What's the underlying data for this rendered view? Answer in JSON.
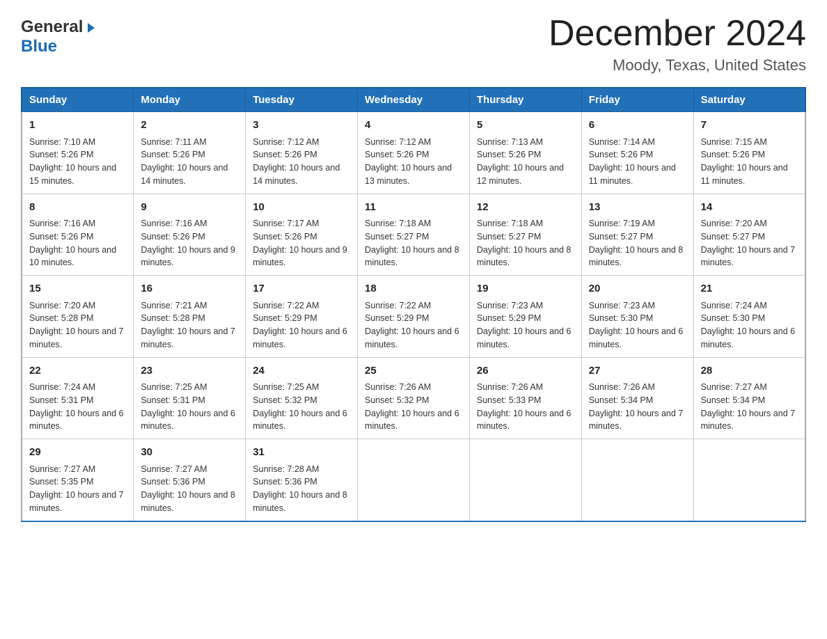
{
  "header": {
    "logo_line1": "General",
    "logo_line2": "Blue",
    "title": "December 2024",
    "subtitle": "Moody, Texas, United States"
  },
  "days_of_week": [
    "Sunday",
    "Monday",
    "Tuesday",
    "Wednesday",
    "Thursday",
    "Friday",
    "Saturday"
  ],
  "weeks": [
    [
      {
        "day": "1",
        "sunrise": "7:10 AM",
        "sunset": "5:26 PM",
        "daylight": "10 hours and 15 minutes."
      },
      {
        "day": "2",
        "sunrise": "7:11 AM",
        "sunset": "5:26 PM",
        "daylight": "10 hours and 14 minutes."
      },
      {
        "day": "3",
        "sunrise": "7:12 AM",
        "sunset": "5:26 PM",
        "daylight": "10 hours and 14 minutes."
      },
      {
        "day": "4",
        "sunrise": "7:12 AM",
        "sunset": "5:26 PM",
        "daylight": "10 hours and 13 minutes."
      },
      {
        "day": "5",
        "sunrise": "7:13 AM",
        "sunset": "5:26 PM",
        "daylight": "10 hours and 12 minutes."
      },
      {
        "day": "6",
        "sunrise": "7:14 AM",
        "sunset": "5:26 PM",
        "daylight": "10 hours and 11 minutes."
      },
      {
        "day": "7",
        "sunrise": "7:15 AM",
        "sunset": "5:26 PM",
        "daylight": "10 hours and 11 minutes."
      }
    ],
    [
      {
        "day": "8",
        "sunrise": "7:16 AM",
        "sunset": "5:26 PM",
        "daylight": "10 hours and 10 minutes."
      },
      {
        "day": "9",
        "sunrise": "7:16 AM",
        "sunset": "5:26 PM",
        "daylight": "10 hours and 9 minutes."
      },
      {
        "day": "10",
        "sunrise": "7:17 AM",
        "sunset": "5:26 PM",
        "daylight": "10 hours and 9 minutes."
      },
      {
        "day": "11",
        "sunrise": "7:18 AM",
        "sunset": "5:27 PM",
        "daylight": "10 hours and 8 minutes."
      },
      {
        "day": "12",
        "sunrise": "7:18 AM",
        "sunset": "5:27 PM",
        "daylight": "10 hours and 8 minutes."
      },
      {
        "day": "13",
        "sunrise": "7:19 AM",
        "sunset": "5:27 PM",
        "daylight": "10 hours and 8 minutes."
      },
      {
        "day": "14",
        "sunrise": "7:20 AM",
        "sunset": "5:27 PM",
        "daylight": "10 hours and 7 minutes."
      }
    ],
    [
      {
        "day": "15",
        "sunrise": "7:20 AM",
        "sunset": "5:28 PM",
        "daylight": "10 hours and 7 minutes."
      },
      {
        "day": "16",
        "sunrise": "7:21 AM",
        "sunset": "5:28 PM",
        "daylight": "10 hours and 7 minutes."
      },
      {
        "day": "17",
        "sunrise": "7:22 AM",
        "sunset": "5:29 PM",
        "daylight": "10 hours and 6 minutes."
      },
      {
        "day": "18",
        "sunrise": "7:22 AM",
        "sunset": "5:29 PM",
        "daylight": "10 hours and 6 minutes."
      },
      {
        "day": "19",
        "sunrise": "7:23 AM",
        "sunset": "5:29 PM",
        "daylight": "10 hours and 6 minutes."
      },
      {
        "day": "20",
        "sunrise": "7:23 AM",
        "sunset": "5:30 PM",
        "daylight": "10 hours and 6 minutes."
      },
      {
        "day": "21",
        "sunrise": "7:24 AM",
        "sunset": "5:30 PM",
        "daylight": "10 hours and 6 minutes."
      }
    ],
    [
      {
        "day": "22",
        "sunrise": "7:24 AM",
        "sunset": "5:31 PM",
        "daylight": "10 hours and 6 minutes."
      },
      {
        "day": "23",
        "sunrise": "7:25 AM",
        "sunset": "5:31 PM",
        "daylight": "10 hours and 6 minutes."
      },
      {
        "day": "24",
        "sunrise": "7:25 AM",
        "sunset": "5:32 PM",
        "daylight": "10 hours and 6 minutes."
      },
      {
        "day": "25",
        "sunrise": "7:26 AM",
        "sunset": "5:32 PM",
        "daylight": "10 hours and 6 minutes."
      },
      {
        "day": "26",
        "sunrise": "7:26 AM",
        "sunset": "5:33 PM",
        "daylight": "10 hours and 6 minutes."
      },
      {
        "day": "27",
        "sunrise": "7:26 AM",
        "sunset": "5:34 PM",
        "daylight": "10 hours and 7 minutes."
      },
      {
        "day": "28",
        "sunrise": "7:27 AM",
        "sunset": "5:34 PM",
        "daylight": "10 hours and 7 minutes."
      }
    ],
    [
      {
        "day": "29",
        "sunrise": "7:27 AM",
        "sunset": "5:35 PM",
        "daylight": "10 hours and 7 minutes."
      },
      {
        "day": "30",
        "sunrise": "7:27 AM",
        "sunset": "5:36 PM",
        "daylight": "10 hours and 8 minutes."
      },
      {
        "day": "31",
        "sunrise": "7:28 AM",
        "sunset": "5:36 PM",
        "daylight": "10 hours and 8 minutes."
      },
      null,
      null,
      null,
      null
    ]
  ]
}
